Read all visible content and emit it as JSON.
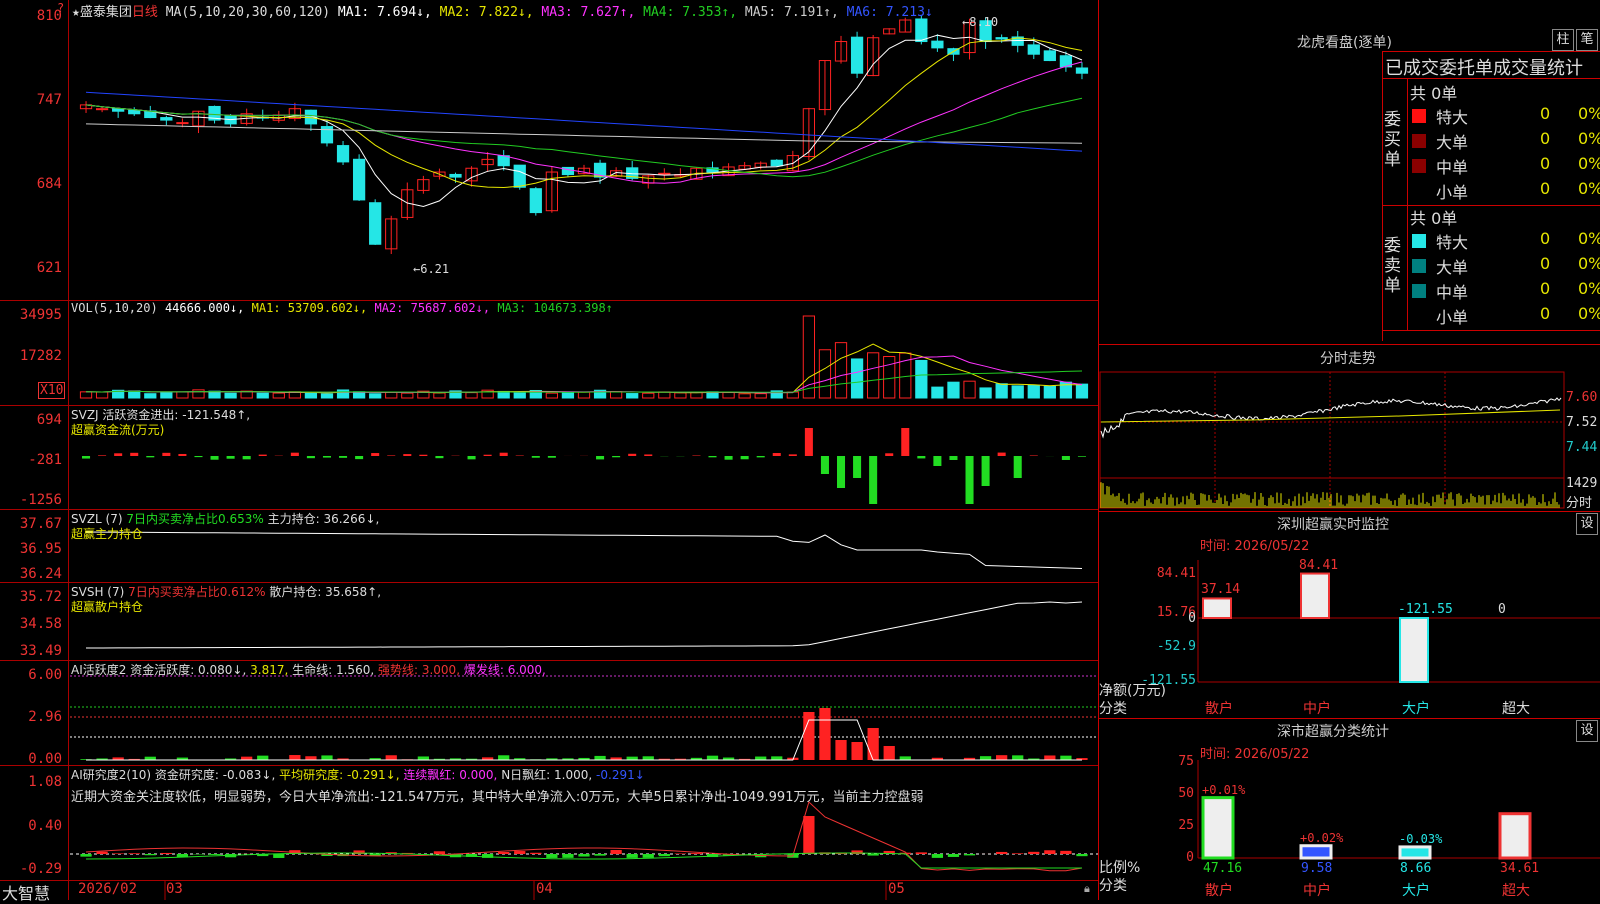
{
  "colors": {
    "up": "#ff2222",
    "down": "#25e6e6",
    "ma1": "#ffffff",
    "ma2": "#e6e600",
    "ma3": "#ff33ff",
    "ma4": "#22cc22",
    "ma5": "#cccccc",
    "ma6": "#2244ff",
    "grid": "#aa0000",
    "green": "#22dd22",
    "yellow": "#e6e600"
  },
  "header": {
    "star": "★",
    "stock_name": "盛泰集团",
    "period": "日线",
    "ma_params": "MA(5,10,20,30,60,120)",
    "ma1": "MA1: 7.694↓,",
    "ma2": "MA2: 7.822↓,",
    "ma3": "MA3: 7.627↑,",
    "ma4": "MA4: 7.353↑,",
    "ma5": "MA5: 7.191↑,",
    "ma6": "MA6: 7.213↓",
    "question": "?"
  },
  "price_axis": [
    "810",
    "747",
    "684",
    "621"
  ],
  "price_marks": {
    "high": "8.10",
    "low": "6.21"
  },
  "vol": {
    "params": "VOL(5,10,20)",
    "value": "44666.000↓,",
    "ma1": "MA1: 53709.602↓,",
    "ma2": "MA2: 75687.602↓,",
    "ma3": "MA3: 104673.398↑",
    "axis": [
      "34995",
      "17282"
    ],
    "unit": "X10"
  },
  "svzj": {
    "title": "SVZJ  活跃资金进出: -121.548↑,",
    "subtitle": "超赢资金流(万元)",
    "axis": [
      "694",
      "-281",
      "-1256"
    ]
  },
  "svzl": {
    "title": "SVZL (7) ",
    "ratio": "7日内买卖净占比0.653%",
    "hold": "主力持仓: 36.266↓,",
    "subtitle": "超赢主力持仓",
    "axis": [
      "37.67",
      "36.95",
      "36.24"
    ]
  },
  "svsh": {
    "title": "SVSH (7) ",
    "ratio": "7日内买卖净占比0.612%",
    "hold": "散户持仓: 35.658↑,",
    "subtitle": "超赢散户持仓",
    "axis": [
      "35.72",
      "34.58",
      "33.49"
    ]
  },
  "ai_active": {
    "title": "AI活跃度2 ",
    "fund": "资金活跃度: 0.080↓,",
    "v2": "3.817,",
    "life": "生命线: 1.560,",
    "strong": "强势线: 3.000,",
    "burst": "爆发线: 6.000,",
    "axis": [
      "6.00",
      "2.96",
      "0.00"
    ]
  },
  "ai_research": {
    "title": "AI研究度2(10) ",
    "fund": "资金研究度: -0.083↓,",
    "avg": "平均研究度: -0.291↓,",
    "cont": "连续飘红: 0.000,",
    "nday": "N日飘红: 1.000,",
    "v5": "-0.291↓",
    "comment": "近期大资金关注度较低，明显弱势，今日大单净流出:-121.547万元，其中特大单净流入:0万元，大单5日累计净出-1049.991万元，当前主力控盘弱",
    "axis": [
      "1.08",
      "0.40",
      "-0.29"
    ]
  },
  "timeline": {
    "brand": "大智慧",
    "dates": [
      "2026/02",
      "03",
      "04",
      "05"
    ]
  },
  "longhu": {
    "title": "龙虎看盘(逐单)",
    "tab1": "柱",
    "tab2": "笔",
    "tabs_header": "已成交委托单成交量统计",
    "buy_label": "委买单",
    "sell_label": "委卖单",
    "buy_total": "共 0单",
    "sell_total": "共 0单",
    "buy_rows": [
      {
        "name": "特大",
        "vol": "0",
        "pct": "0%"
      },
      {
        "name": "大单",
        "vol": "0",
        "pct": "0%"
      },
      {
        "name": "中单",
        "vol": "0",
        "pct": "0%"
      },
      {
        "name": "小单",
        "vol": "0",
        "pct": "0%"
      }
    ],
    "sell_rows": [
      {
        "name": "特大",
        "vol": "0",
        "pct": "0%"
      },
      {
        "name": "大单",
        "vol": "0",
        "pct": "0%"
      },
      {
        "name": "中单",
        "vol": "0",
        "pct": "0%"
      },
      {
        "name": "小单",
        "vol": "0",
        "pct": "0%"
      }
    ]
  },
  "intraday": {
    "title": "分时走势",
    "axis": [
      "7.60",
      "7.52",
      "7.44"
    ],
    "vol_axis": "1429",
    "unit": "分时"
  },
  "monitor": {
    "title": "深圳超赢实时监控",
    "set": "设",
    "time": "时间: 2026/05/22",
    "axis": [
      "84.41",
      "15.76",
      "0",
      "-52.9",
      "-121.55"
    ],
    "y_label": "净额(万元)",
    "x_label": "分类",
    "values": [
      "37.14",
      "84.41",
      "-121.55",
      "0"
    ],
    "cats": [
      "散户",
      "中户",
      "大户",
      "超大"
    ]
  },
  "classify": {
    "title": "深市超赢分类统计",
    "set": "设",
    "time": "时间: 2026/05/22",
    "axis": [
      "75",
      "50",
      "25",
      "0"
    ],
    "y_label": "比例%",
    "x_label": "分类",
    "changes": [
      "+0.01%",
      "+0.02%",
      "-0.03%",
      ""
    ],
    "values": [
      "47.16",
      "9.58",
      "8.66",
      "34.61"
    ],
    "cats": [
      "散户",
      "中户",
      "大户",
      "超大"
    ]
  }
}
